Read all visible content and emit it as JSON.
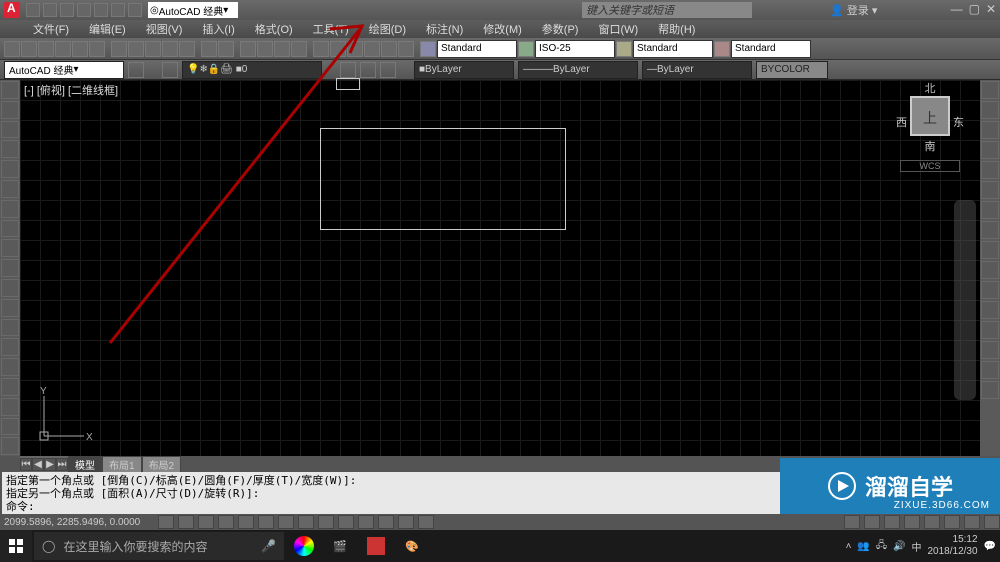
{
  "title_ws": "AutoCAD 经典",
  "search_placeholder": "键入关键字或短语",
  "login_label": "登录",
  "menu": [
    "文件(F)",
    "编辑(E)",
    "视图(V)",
    "插入(I)",
    "格式(O)",
    "工具(T)",
    "绘图(D)",
    "标注(N)",
    "修改(M)",
    "参数(P)",
    "窗口(W)",
    "帮助(H)"
  ],
  "styles": {
    "text": "Standard",
    "dim": "ISO-25",
    "table": "Standard",
    "mleader": "Standard"
  },
  "workspace_combo": "AutoCAD 经典",
  "layer": "0",
  "props": {
    "color": "ByLayer",
    "linetype": "ByLayer",
    "lineweight": "ByLayer",
    "plot": "BYCOLOR"
  },
  "viewport_label": "[-] [俯视] [二维线框]",
  "viewcube": {
    "top": "上",
    "n": "北",
    "s": "南",
    "e": "东",
    "w": "西",
    "wcs": "WCS"
  },
  "ucs": {
    "x": "X",
    "y": "Y"
  },
  "tabs": {
    "model": "模型",
    "layout1": "布局1",
    "layout2": "布局2"
  },
  "cmd": {
    "line1": "指定第一个角点或 [倒角(C)/标高(E)/圆角(F)/厚度(T)/宽度(W)]:",
    "line2": "指定另一个角点或 [面积(A)/尺寸(D)/旋转(R)]:",
    "prompt": "命令:"
  },
  "coords": "2099.5896, 2285.9496, 0.0000",
  "watermark": {
    "brand": "溜溜自学",
    "url": "ZIXUE.3D66.COM"
  },
  "win_search": "在这里输入你要搜索的内容",
  "clock": {
    "time": "15:12",
    "date": "2018/12/30"
  }
}
